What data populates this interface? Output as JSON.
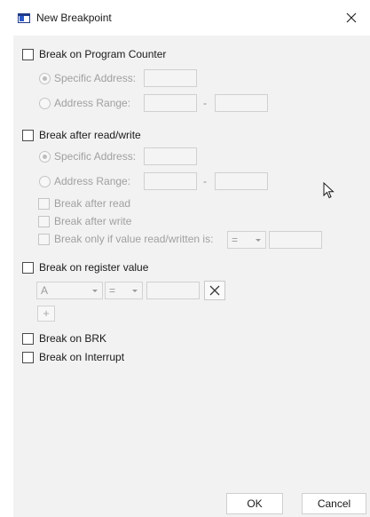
{
  "window": {
    "title": "New Breakpoint",
    "app_icon": "window-icon",
    "close_icon": "close-icon"
  },
  "program_counter": {
    "label": "Break on Program Counter",
    "specific_address_label": "Specific Address:",
    "address_range_label": "Address Range:",
    "range_separator": "-",
    "specific_address_value": "",
    "range_start_value": "",
    "range_end_value": ""
  },
  "read_write": {
    "label": "Break after read/write",
    "specific_address_label": "Specific Address:",
    "address_range_label": "Address Range:",
    "range_separator": "-",
    "break_after_read_label": "Break after read",
    "break_after_write_label": "Break after write",
    "break_only_if_label": "Break only if value read/written is:",
    "compare_operator": "=",
    "compare_value": ""
  },
  "register": {
    "label": "Break on register value",
    "register_selected": "A",
    "operator_selected": "=",
    "value": "",
    "remove_icon": "close-x-icon",
    "add_label": "+"
  },
  "brk": {
    "label": "Break on BRK"
  },
  "interrupt": {
    "label": "Break on Interrupt"
  },
  "footer": {
    "ok_label": "OK",
    "cancel_label": "Cancel"
  }
}
